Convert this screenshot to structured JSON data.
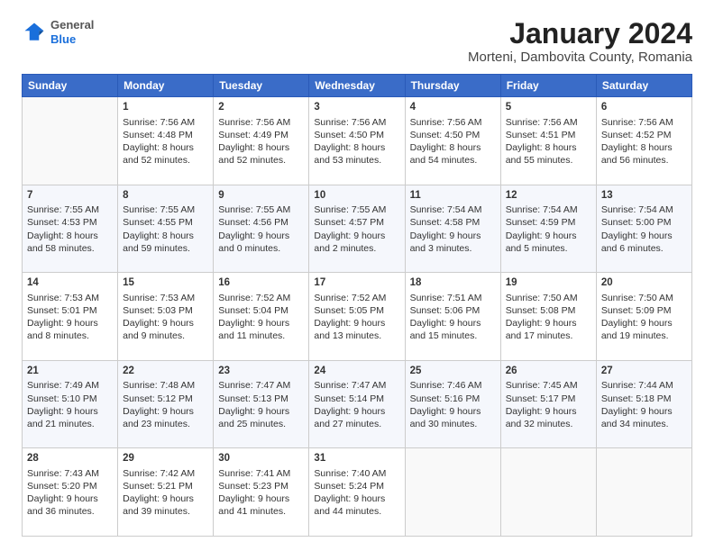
{
  "header": {
    "logo": {
      "general": "General",
      "blue": "Blue"
    },
    "title": "January 2024",
    "location": "Morteni, Dambovita County, Romania"
  },
  "weekdays": [
    "Sunday",
    "Monday",
    "Tuesday",
    "Wednesday",
    "Thursday",
    "Friday",
    "Saturday"
  ],
  "weeks": [
    [
      {
        "day": "",
        "sunrise": "",
        "sunset": "",
        "daylight": ""
      },
      {
        "day": "1",
        "sunrise": "Sunrise: 7:56 AM",
        "sunset": "Sunset: 4:48 PM",
        "daylight": "Daylight: 8 hours and 52 minutes."
      },
      {
        "day": "2",
        "sunrise": "Sunrise: 7:56 AM",
        "sunset": "Sunset: 4:49 PM",
        "daylight": "Daylight: 8 hours and 52 minutes."
      },
      {
        "day": "3",
        "sunrise": "Sunrise: 7:56 AM",
        "sunset": "Sunset: 4:50 PM",
        "daylight": "Daylight: 8 hours and 53 minutes."
      },
      {
        "day": "4",
        "sunrise": "Sunrise: 7:56 AM",
        "sunset": "Sunset: 4:50 PM",
        "daylight": "Daylight: 8 hours and 54 minutes."
      },
      {
        "day": "5",
        "sunrise": "Sunrise: 7:56 AM",
        "sunset": "Sunset: 4:51 PM",
        "daylight": "Daylight: 8 hours and 55 minutes."
      },
      {
        "day": "6",
        "sunrise": "Sunrise: 7:56 AM",
        "sunset": "Sunset: 4:52 PM",
        "daylight": "Daylight: 8 hours and 56 minutes."
      }
    ],
    [
      {
        "day": "7",
        "sunrise": "Sunrise: 7:55 AM",
        "sunset": "Sunset: 4:53 PM",
        "daylight": "Daylight: 8 hours and 58 minutes."
      },
      {
        "day": "8",
        "sunrise": "Sunrise: 7:55 AM",
        "sunset": "Sunset: 4:55 PM",
        "daylight": "Daylight: 8 hours and 59 minutes."
      },
      {
        "day": "9",
        "sunrise": "Sunrise: 7:55 AM",
        "sunset": "Sunset: 4:56 PM",
        "daylight": "Daylight: 9 hours and 0 minutes."
      },
      {
        "day": "10",
        "sunrise": "Sunrise: 7:55 AM",
        "sunset": "Sunset: 4:57 PM",
        "daylight": "Daylight: 9 hours and 2 minutes."
      },
      {
        "day": "11",
        "sunrise": "Sunrise: 7:54 AM",
        "sunset": "Sunset: 4:58 PM",
        "daylight": "Daylight: 9 hours and 3 minutes."
      },
      {
        "day": "12",
        "sunrise": "Sunrise: 7:54 AM",
        "sunset": "Sunset: 4:59 PM",
        "daylight": "Daylight: 9 hours and 5 minutes."
      },
      {
        "day": "13",
        "sunrise": "Sunrise: 7:54 AM",
        "sunset": "Sunset: 5:00 PM",
        "daylight": "Daylight: 9 hours and 6 minutes."
      }
    ],
    [
      {
        "day": "14",
        "sunrise": "Sunrise: 7:53 AM",
        "sunset": "Sunset: 5:01 PM",
        "daylight": "Daylight: 9 hours and 8 minutes."
      },
      {
        "day": "15",
        "sunrise": "Sunrise: 7:53 AM",
        "sunset": "Sunset: 5:03 PM",
        "daylight": "Daylight: 9 hours and 9 minutes."
      },
      {
        "day": "16",
        "sunrise": "Sunrise: 7:52 AM",
        "sunset": "Sunset: 5:04 PM",
        "daylight": "Daylight: 9 hours and 11 minutes."
      },
      {
        "day": "17",
        "sunrise": "Sunrise: 7:52 AM",
        "sunset": "Sunset: 5:05 PM",
        "daylight": "Daylight: 9 hours and 13 minutes."
      },
      {
        "day": "18",
        "sunrise": "Sunrise: 7:51 AM",
        "sunset": "Sunset: 5:06 PM",
        "daylight": "Daylight: 9 hours and 15 minutes."
      },
      {
        "day": "19",
        "sunrise": "Sunrise: 7:50 AM",
        "sunset": "Sunset: 5:08 PM",
        "daylight": "Daylight: 9 hours and 17 minutes."
      },
      {
        "day": "20",
        "sunrise": "Sunrise: 7:50 AM",
        "sunset": "Sunset: 5:09 PM",
        "daylight": "Daylight: 9 hours and 19 minutes."
      }
    ],
    [
      {
        "day": "21",
        "sunrise": "Sunrise: 7:49 AM",
        "sunset": "Sunset: 5:10 PM",
        "daylight": "Daylight: 9 hours and 21 minutes."
      },
      {
        "day": "22",
        "sunrise": "Sunrise: 7:48 AM",
        "sunset": "Sunset: 5:12 PM",
        "daylight": "Daylight: 9 hours and 23 minutes."
      },
      {
        "day": "23",
        "sunrise": "Sunrise: 7:47 AM",
        "sunset": "Sunset: 5:13 PM",
        "daylight": "Daylight: 9 hours and 25 minutes."
      },
      {
        "day": "24",
        "sunrise": "Sunrise: 7:47 AM",
        "sunset": "Sunset: 5:14 PM",
        "daylight": "Daylight: 9 hours and 27 minutes."
      },
      {
        "day": "25",
        "sunrise": "Sunrise: 7:46 AM",
        "sunset": "Sunset: 5:16 PM",
        "daylight": "Daylight: 9 hours and 30 minutes."
      },
      {
        "day": "26",
        "sunrise": "Sunrise: 7:45 AM",
        "sunset": "Sunset: 5:17 PM",
        "daylight": "Daylight: 9 hours and 32 minutes."
      },
      {
        "day": "27",
        "sunrise": "Sunrise: 7:44 AM",
        "sunset": "Sunset: 5:18 PM",
        "daylight": "Daylight: 9 hours and 34 minutes."
      }
    ],
    [
      {
        "day": "28",
        "sunrise": "Sunrise: 7:43 AM",
        "sunset": "Sunset: 5:20 PM",
        "daylight": "Daylight: 9 hours and 36 minutes."
      },
      {
        "day": "29",
        "sunrise": "Sunrise: 7:42 AM",
        "sunset": "Sunset: 5:21 PM",
        "daylight": "Daylight: 9 hours and 39 minutes."
      },
      {
        "day": "30",
        "sunrise": "Sunrise: 7:41 AM",
        "sunset": "Sunset: 5:23 PM",
        "daylight": "Daylight: 9 hours and 41 minutes."
      },
      {
        "day": "31",
        "sunrise": "Sunrise: 7:40 AM",
        "sunset": "Sunset: 5:24 PM",
        "daylight": "Daylight: 9 hours and 44 minutes."
      },
      {
        "day": "",
        "sunrise": "",
        "sunset": "",
        "daylight": ""
      },
      {
        "day": "",
        "sunrise": "",
        "sunset": "",
        "daylight": ""
      },
      {
        "day": "",
        "sunrise": "",
        "sunset": "",
        "daylight": ""
      }
    ]
  ]
}
